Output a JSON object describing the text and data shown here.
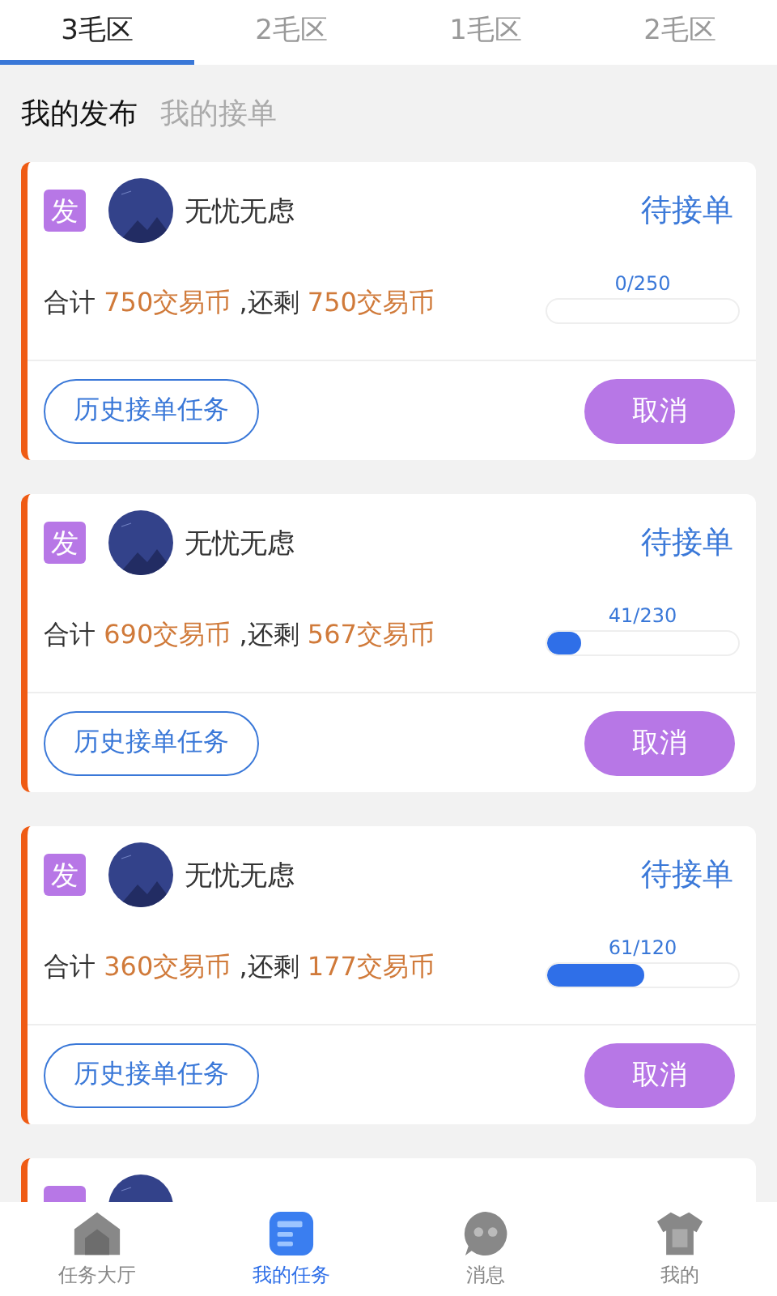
{
  "tabs": [
    {
      "label": "3毛区",
      "selected": true
    },
    {
      "label": "2毛区",
      "selected": false
    },
    {
      "label": "1毛区",
      "selected": false
    },
    {
      "label": "2毛区",
      "selected": false
    }
  ],
  "subtabs": [
    {
      "label": "我的发布",
      "selected": true
    },
    {
      "label": "我的接单",
      "selected": false
    }
  ],
  "cards": [
    {
      "kind": "full",
      "badge": "发",
      "name": "无忧无虑",
      "status": "待接单",
      "total_label": "合计",
      "total": "750交易币",
      "remain_label": ",还剩",
      "remain": "750交易币",
      "progress_text": "0/250",
      "level": 0,
      "history_button": "历史接单任务",
      "cancel_button": "取消"
    },
    {
      "kind": "full",
      "badge": "发",
      "name": "无忧无虑",
      "status": "待接单",
      "total_label": "合计",
      "total": "690交易币",
      "remain_label": ",还剩",
      "remain": "567交易币",
      "progress_text": "41/230",
      "level": 0.18,
      "history_button": "历史接单任务",
      "cancel_button": "取消"
    },
    {
      "kind": "full",
      "badge": "发",
      "name": "无忧无虑",
      "status": "待接单",
      "total_label": "合计",
      "total": "360交易币",
      "remain_label": ",还剩",
      "remain": "177交易币",
      "progress_text": "61/120",
      "level": 0.51,
      "history_button": "历史接单任务",
      "cancel_button": "取消"
    },
    {
      "kind": "clipped"
    }
  ],
  "nav": [
    {
      "kind": "home",
      "label": "任务大厅",
      "selected": false
    },
    {
      "kind": "tasks",
      "label": "我的任务",
      "selected": true
    },
    {
      "kind": "chat",
      "label": "消息",
      "selected": false
    },
    {
      "kind": "shirt",
      "label": "我的",
      "selected": false
    }
  ]
}
